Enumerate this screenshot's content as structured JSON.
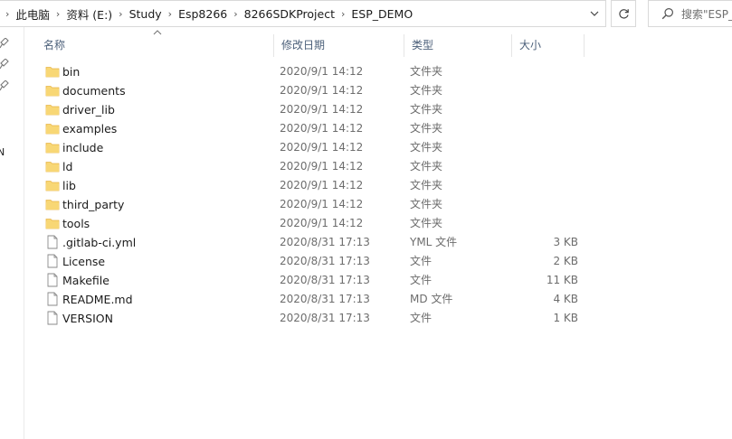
{
  "address_bar": {
    "breadcrumbs": [
      "此电脑",
      "资料 (E:)",
      "Study",
      "Esp8266",
      "8266SDKProject",
      "ESP_DEMO"
    ]
  },
  "search": {
    "placeholder": "搜索\"ESP_DEMO\"",
    "visible_text": "搜索\"ESP_"
  },
  "nav_pane": {
    "partial_label": "N"
  },
  "columns": {
    "name": "名称",
    "date": "修改日期",
    "type": "类型",
    "size": "大小"
  },
  "files": [
    {
      "name": "bin",
      "date": "2020/9/1 14:12",
      "type": "文件夹",
      "size": "",
      "icon": "folder-icon"
    },
    {
      "name": "documents",
      "date": "2020/9/1 14:12",
      "type": "文件夹",
      "size": "",
      "icon": "folder-icon"
    },
    {
      "name": "driver_lib",
      "date": "2020/9/1 14:12",
      "type": "文件夹",
      "size": "",
      "icon": "folder-icon"
    },
    {
      "name": "examples",
      "date": "2020/9/1 14:12",
      "type": "文件夹",
      "size": "",
      "icon": "folder-icon"
    },
    {
      "name": "include",
      "date": "2020/9/1 14:12",
      "type": "文件夹",
      "size": "",
      "icon": "folder-icon"
    },
    {
      "name": "ld",
      "date": "2020/9/1 14:12",
      "type": "文件夹",
      "size": "",
      "icon": "folder-icon"
    },
    {
      "name": "lib",
      "date": "2020/9/1 14:12",
      "type": "文件夹",
      "size": "",
      "icon": "folder-icon"
    },
    {
      "name": "third_party",
      "date": "2020/9/1 14:12",
      "type": "文件夹",
      "size": "",
      "icon": "folder-icon"
    },
    {
      "name": "tools",
      "date": "2020/9/1 14:12",
      "type": "文件夹",
      "size": "",
      "icon": "folder-icon"
    },
    {
      "name": ".gitlab-ci.yml",
      "date": "2020/8/31 17:13",
      "type": "YML 文件",
      "size": "3 KB",
      "icon": "file-icon"
    },
    {
      "name": "License",
      "date": "2020/8/31 17:13",
      "type": "文件",
      "size": "2 KB",
      "icon": "file-icon"
    },
    {
      "name": "Makefile",
      "date": "2020/8/31 17:13",
      "type": "文件",
      "size": "11 KB",
      "icon": "file-icon"
    },
    {
      "name": "README.md",
      "date": "2020/8/31 17:13",
      "type": "MD 文件",
      "size": "4 KB",
      "icon": "file-icon"
    },
    {
      "name": "VERSION",
      "date": "2020/8/31 17:13",
      "type": "文件",
      "size": "1 KB",
      "icon": "file-icon"
    }
  ],
  "colors": {
    "folder": "#f8d775",
    "folder_dark": "#e8b64a",
    "header_text": "#4c607a",
    "secondary_text": "#6d6d6d"
  }
}
